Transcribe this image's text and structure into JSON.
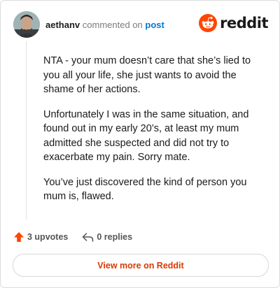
{
  "header": {
    "username": "aethanv",
    "action_text": "commented on",
    "post_link": "post"
  },
  "brand": {
    "logo_text": "reddit",
    "color": "#ff4500"
  },
  "comment": {
    "paragraphs": [
      "NTA - your mum doesn’t care that she’s lied to you all your life, she just wants to avoid the shame of her actions.",
      "Unfortunately I was in the same situation, and found out in my early 20’s, at least my mum admitted she suspected and did not try to exacerbate my pain. Sorry mate.",
      "You’ve just discovered the kind of person you mum is, flawed."
    ]
  },
  "footer": {
    "upvotes_label": "3 upvotes",
    "replies_label": "0 replies",
    "upvote_icon": "arrow-up-icon",
    "reply_icon": "reply-arrow-icon",
    "upvote_color": "#ff4500"
  },
  "actions": {
    "view_more_label": "View more on Reddit",
    "view_more_color": "#d93a00"
  }
}
